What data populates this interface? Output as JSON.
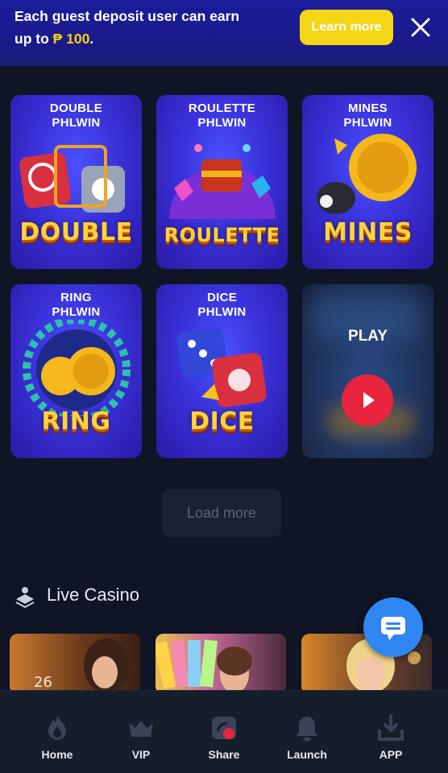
{
  "banner": {
    "line1": "Each guest deposit user can earn",
    "line2_prefix": "up to ",
    "currency": "₱",
    "amount": " 100",
    "line2_suffix": ".",
    "learn_more": "Learn more"
  },
  "games": [
    {
      "title_line1": "DOUBLE",
      "title_line2": "PHLWIN",
      "logo": "DOUBLE"
    },
    {
      "title_line1": "ROULETTE",
      "title_line2": "PHLWIN",
      "logo": "ROULETTE"
    },
    {
      "title_line1": "MINES",
      "title_line2": "PHLWIN",
      "logo": "MINES"
    },
    {
      "title_line1": "RING",
      "title_line2": "PHLWIN",
      "logo": "RING"
    },
    {
      "title_line1": "DICE",
      "title_line2": "PHLWIN",
      "logo": "DICE"
    }
  ],
  "play_card": {
    "label": "PLAY"
  },
  "load_more": "Load more",
  "live_casino": {
    "title": "Live Casino"
  },
  "nav": [
    {
      "label": "Home",
      "icon": "flame-icon"
    },
    {
      "label": "VIP",
      "icon": "crown-icon"
    },
    {
      "label": "Share",
      "icon": "share-icon"
    },
    {
      "label": "Launch",
      "icon": "bell-icon"
    },
    {
      "label": "APP",
      "icon": "download-icon"
    }
  ],
  "colors": {
    "banner_bg": "#1a1d9a",
    "accent_yellow": "#f4d616",
    "page_bg": "#0f1524",
    "play_red": "#e8243f",
    "chat_blue": "#2f86f1"
  }
}
